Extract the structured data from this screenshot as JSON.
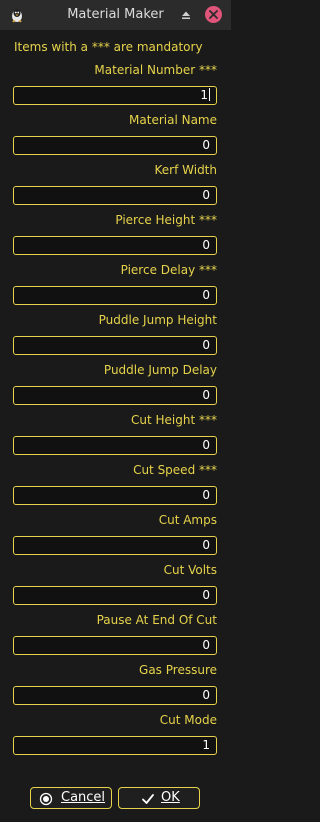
{
  "window": {
    "title": "Material Maker",
    "app_icon": "linuxcnc-tux-icon",
    "controls": [
      "roll-up-icon",
      "close-icon"
    ]
  },
  "header_note": "Items with a *** are mandatory",
  "fields": [
    {
      "label": "Material Number ***",
      "value": "1"
    },
    {
      "label": "Material Name",
      "value": "0"
    },
    {
      "label": "Kerf Width",
      "value": "0"
    },
    {
      "label": "Pierce Height ***",
      "value": "0"
    },
    {
      "label": "Pierce Delay ***",
      "value": "0"
    },
    {
      "label": "Puddle Jump Height",
      "value": "0"
    },
    {
      "label": "Puddle Jump Delay",
      "value": "0"
    },
    {
      "label": "Cut Height ***",
      "value": "0"
    },
    {
      "label": "Cut Speed ***",
      "value": "0"
    },
    {
      "label": "Cut Amps",
      "value": "0"
    },
    {
      "label": "Cut Volts",
      "value": "0"
    },
    {
      "label": "Pause At End Of Cut",
      "value": "0"
    },
    {
      "label": "Gas Pressure",
      "value": "0"
    },
    {
      "label": "Cut Mode",
      "value": "1"
    }
  ],
  "buttons": {
    "cancel": {
      "label": "Cancel",
      "icon": "radio-circle-icon"
    },
    "ok": {
      "label": "OK",
      "icon": "checkmark-icon"
    }
  },
  "colors": {
    "accent": "#e6d34b",
    "background": "#1a1a1a",
    "titlebar": "#2b2b2b",
    "close_button": "#e0547a"
  }
}
